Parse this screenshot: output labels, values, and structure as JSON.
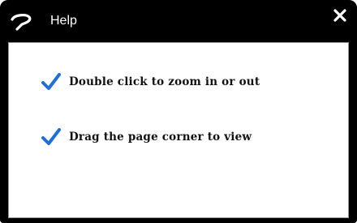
{
  "dialog": {
    "title": "Help",
    "icons": {
      "help": "question-mark-icon",
      "close": "close-icon",
      "check": "checkmark-icon"
    },
    "colors": {
      "titlebar": "#000000",
      "check": "#1e6fd9",
      "text": "#111111",
      "content_bg": "#ffffff"
    }
  },
  "help_items": [
    {
      "text": "Double click to zoom in or out"
    },
    {
      "text": "Drag the page corner to view"
    }
  ]
}
